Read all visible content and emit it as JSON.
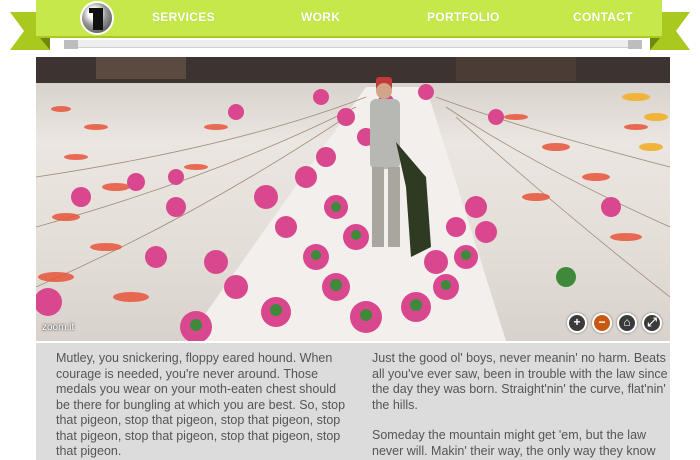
{
  "nav": {
    "items": [
      {
        "label": "SERVICES"
      },
      {
        "label": "WORK"
      },
      {
        "label": "PORTFOLIO"
      },
      {
        "label": "CONTACT"
      }
    ],
    "brand_color": "#c6e84a"
  },
  "photo": {
    "watermark": "zoom.it",
    "controls": [
      {
        "icon": "zoom-in-icon",
        "glyph": "+"
      },
      {
        "icon": "zoom-out-icon",
        "glyph": "−"
      },
      {
        "icon": "home-icon",
        "glyph": "⌂"
      },
      {
        "icon": "fullscreen-icon",
        "glyph": "⤢"
      }
    ]
  },
  "content": {
    "left_paragraphs": [
      "Mutley, you snickering, floppy eared hound. When courage is needed, you're never around. Those medals you wear on your moth-eaten chest should be there for bungling at which you are best. So, stop that pigeon, stop that pigeon, stop that pigeon, stop that pigeon, stop that pigeon, stop that pigeon, stop that pigeon."
    ],
    "right_paragraphs": [
      "Just the good ol' boys, never meanin' no harm. Beats all you've ever saw, been in trouble with the law since the day they was born. Straight'nin' the curve, flat'nin' the hills.",
      "Someday the mountain might get 'em, but the law never will. Makin' their way, the only way they know how."
    ]
  }
}
